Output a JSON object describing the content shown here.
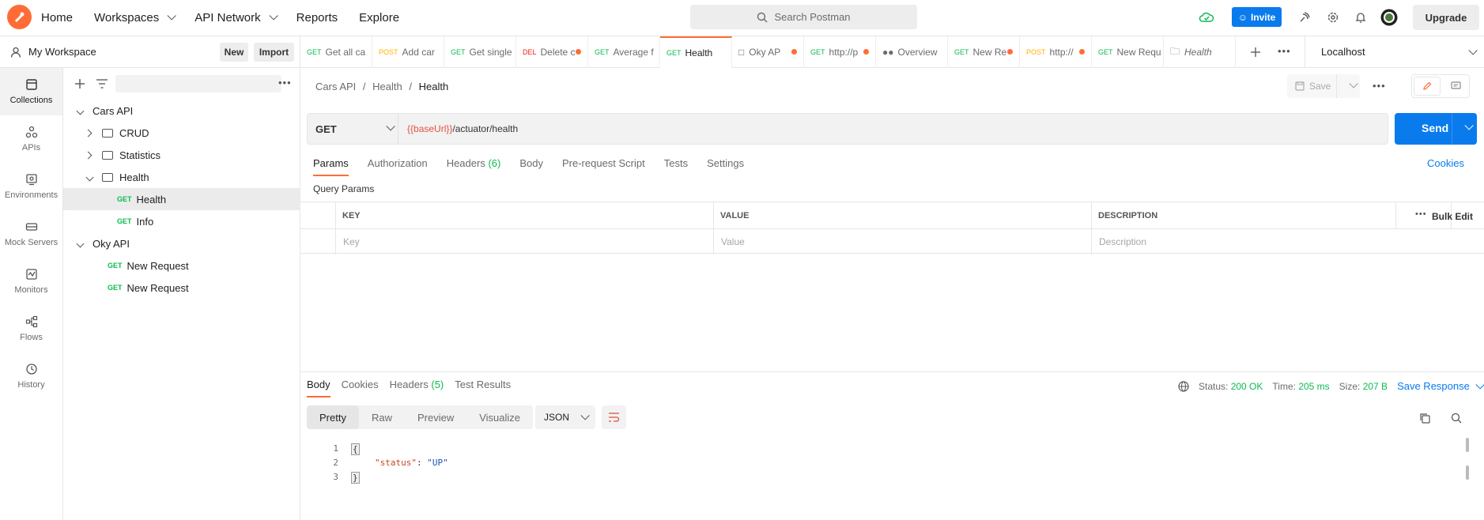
{
  "topbar": {
    "nav": [
      "Home",
      "Workspaces",
      "API Network",
      "Reports",
      "Explore"
    ],
    "search_placeholder": "Search Postman",
    "invite_label": "Invite",
    "upgrade_label": "Upgrade"
  },
  "workspace": {
    "title": "My Workspace",
    "new_label": "New",
    "import_label": "Import"
  },
  "rail": [
    {
      "label": "Collections",
      "icon": "collections-icon"
    },
    {
      "label": "APIs",
      "icon": "apis-icon"
    },
    {
      "label": "Environments",
      "icon": "environments-icon"
    },
    {
      "label": "Mock Servers",
      "icon": "mock-servers-icon"
    },
    {
      "label": "Monitors",
      "icon": "monitors-icon"
    },
    {
      "label": "Flows",
      "icon": "flows-icon"
    },
    {
      "label": "History",
      "icon": "history-icon"
    }
  ],
  "tree": {
    "cars_api": "Cars API",
    "crud": "CRUD",
    "statistics": "Statistics",
    "health_folder": "Health",
    "health_req": "Health",
    "info_req": "Info",
    "oky_api": "Oky API",
    "new_request_1": "New Request",
    "new_request_2": "New Request",
    "get": "GET"
  },
  "tabs": [
    {
      "method": "GET",
      "label": "Get all ca"
    },
    {
      "method": "POST",
      "label": "Add car"
    },
    {
      "method": "GET",
      "label": "Get single"
    },
    {
      "method": "DEL",
      "label": "Delete c"
    },
    {
      "method": "GET",
      "label": "Average f"
    },
    {
      "method": "GET",
      "label": "Health"
    },
    {
      "method": "",
      "label": "Oky AP"
    },
    {
      "method": "GET",
      "label": "http://p"
    },
    {
      "method": "",
      "label": "Overview"
    },
    {
      "method": "GET",
      "label": "New Re"
    },
    {
      "method": "POST",
      "label": "http://"
    },
    {
      "method": "GET",
      "label": "New Requ"
    },
    {
      "method": "",
      "label": "Health"
    }
  ],
  "environment": "Localhost",
  "breadcrumb": {
    "a": "Cars API",
    "b": "Health",
    "c": "Health",
    "sep": "/"
  },
  "save_label": "Save",
  "request": {
    "method": "GET",
    "url_var": "{{baseUrl}}",
    "url_path": "/actuator/health",
    "send_label": "Send"
  },
  "req_tabs": {
    "params": "Params",
    "authorization": "Authorization",
    "headers": "Headers",
    "headers_count": "(6)",
    "body": "Body",
    "prerequest": "Pre-request Script",
    "tests": "Tests",
    "settings": "Settings",
    "cookies": "Cookies"
  },
  "query_params": {
    "title": "Query Params",
    "key_col": "KEY",
    "value_col": "VALUE",
    "desc_col": "DESCRIPTION",
    "bulk_edit": "Bulk Edit",
    "key_ph": "Key",
    "value_ph": "Value",
    "desc_ph": "Description"
  },
  "response": {
    "tabs": {
      "body": "Body",
      "cookies": "Cookies",
      "headers": "Headers",
      "headers_count": "(5)",
      "tests": "Test Results"
    },
    "status_label": "Status:",
    "status_value": "200 OK",
    "time_label": "Time:",
    "time_value": "205 ms",
    "size_label": "Size:",
    "size_value": "207 B",
    "save_response": "Save Response",
    "views": [
      "Pretty",
      "Raw",
      "Preview",
      "Visualize"
    ],
    "format": "JSON",
    "code": {
      "l1": "1",
      "l2": "2",
      "l3": "3",
      "open": "{",
      "key": "\"status\"",
      "colon": ": ",
      "val": "\"UP\"",
      "close": "}"
    }
  },
  "colors": {
    "accent": "#ff6c37",
    "primary": "#097bed",
    "get": "#0cbb52",
    "post": "#ffb400",
    "delete": "#eb2013"
  }
}
